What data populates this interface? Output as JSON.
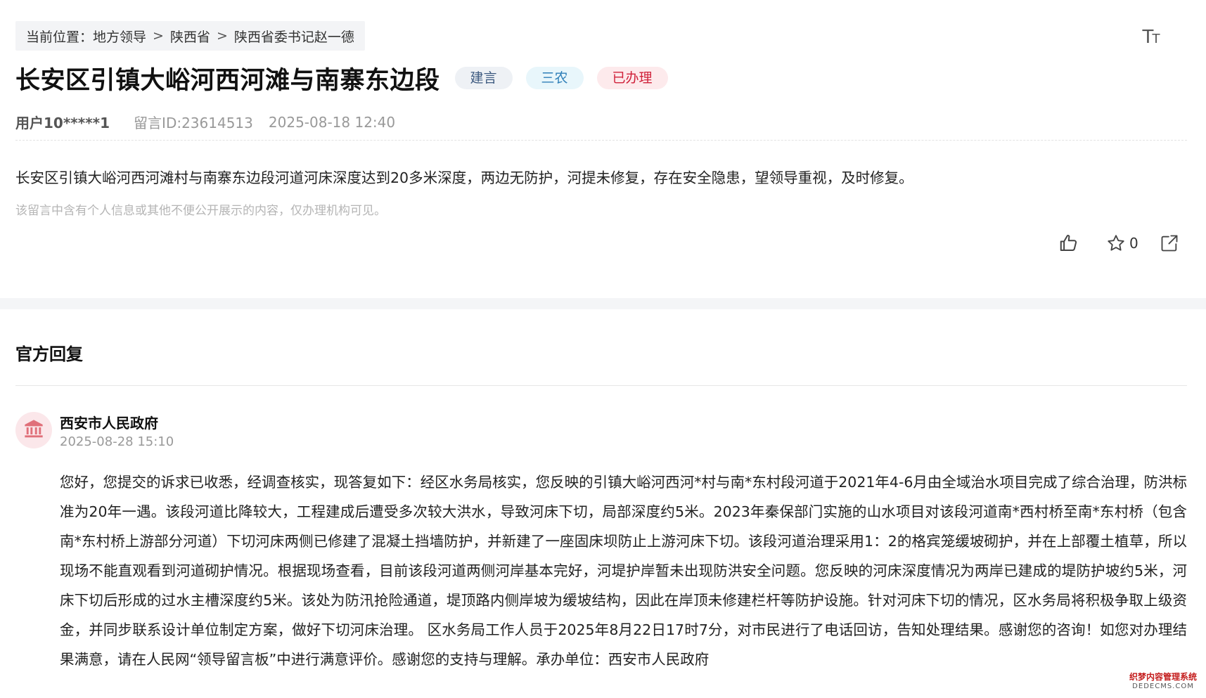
{
  "breadcrumb": {
    "prefix": "当前位置：",
    "items": [
      "地方领导",
      "陕西省",
      "陕西省委书记赵一德"
    ],
    "separator": ">"
  },
  "font_size_toggle": {
    "big": "T",
    "small": "T"
  },
  "post": {
    "title": "长安区引镇大峪河西河滩与南寨东边段",
    "tags": [
      "建言",
      "三农",
      "已办理"
    ],
    "user": "用户10*****1",
    "message_id": "留言ID:23614513",
    "time": "2025-08-18 12:40",
    "content": "长安区引镇大峪河西河滩村与南寨东边段河道河床深度达到20多米深度，两边无防护，河提未修复，存在安全隐患，望领导重视，及时修复。",
    "notice": "该留言中含有个人信息或其他不便公开展示的内容，仅办理机构可见。",
    "favorite_count": "0"
  },
  "icons": {
    "like": "thumbs-up-icon",
    "favorite": "star-icon",
    "share": "share-icon",
    "avatar": "government-building-icon"
  },
  "reply": {
    "heading": "官方回复",
    "org": "西安市人民政府",
    "time": "2025-08-28 15:10",
    "body": "您好，您提交的诉求已收悉，经调查核实，现答复如下：经区水务局核实，您反映的引镇大峪河西河*村与南*东村段河道于2021年4-6月由全域治水项目完成了综合治理，防洪标准为20年一遇。该段河道比降较大，工程建成后遭受多次较大洪水，导致河床下切，局部深度约5米。2023年秦保部门实施的山水项目对该段河道南*西村桥至南*东村桥（包含南*东村桥上游部分河道）下切河床两侧已修建了混凝土挡墙防护，并新建了一座固床坝防止上游河床下切。该段河道治理采用1：2的格宾笼缓坡砌护，并在上部覆土植草，所以现场不能直观看到河道砌护情况。根据现场查看，目前该段河道两侧河岸基本完好，河堤护岸暂未出现防洪安全问题。您反映的河床深度情况为两岸已建成的堤防护坡约5米，河床下切后形成的过水主槽深度约5米。该处为防汛抢险通道，堤顶路内侧岸坡为缓坡结构，因此在岸顶未修建栏杆等防护设施。针对河床下切的情况，区水务局将积极争取上级资金，并同步联系设计单位制定方案，做好下切河床治理。 区水务局工作人员于2025年8月22日17时7分，对市民进行了电话回访，告知处理结果。感谢您的咨询！如您对办理结果满意，请在人民网“领导留言板”中进行满意评价。感谢您的支持与理解。承办单位：西安市人民政府"
  },
  "watermark": {
    "line1": "织梦内容管理系统",
    "line2": "DEDECMS.COM"
  },
  "colors": {
    "tag_suggestion": "#3d5a80",
    "tag_agriculture": "#2e7fb8",
    "tag_done": "#d0213a",
    "avatar_bg": "#fbe7ea",
    "avatar_icon": "#e0707a"
  }
}
